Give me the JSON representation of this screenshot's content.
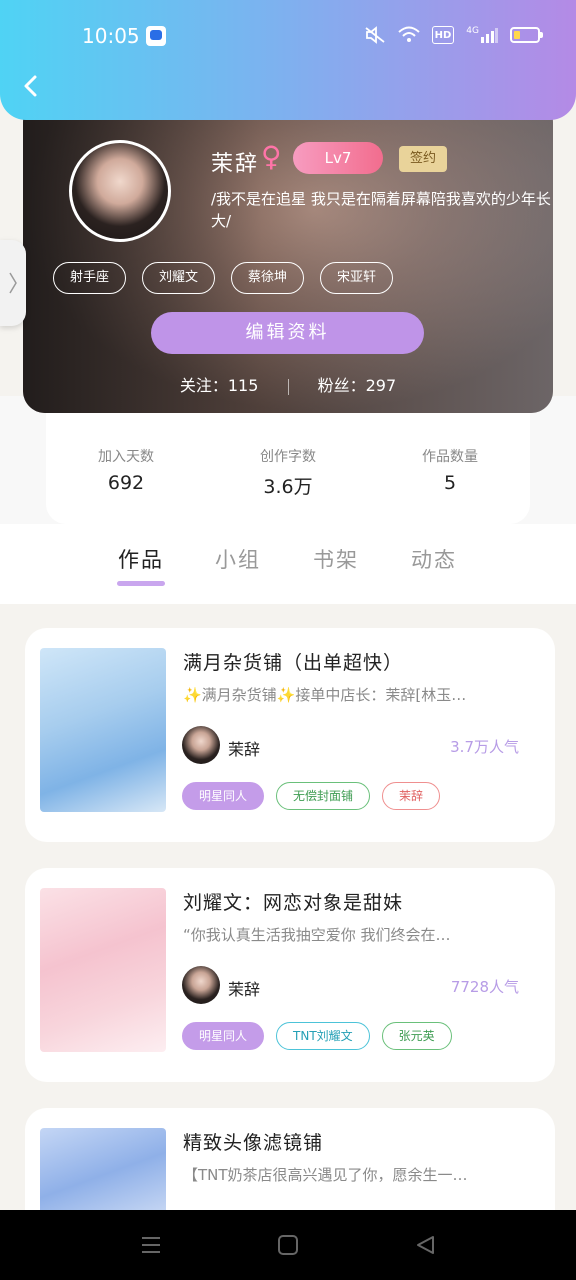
{
  "status_bar": {
    "time": "10:05",
    "network_label": "4G",
    "hd_label": "HD",
    "icons": [
      "mute-icon",
      "wifi-icon",
      "hd-icon",
      "signal-icon",
      "battery-icon"
    ]
  },
  "header": {
    "back_icon": "back-arrow-icon"
  },
  "profile": {
    "username": "茉辞",
    "gender_symbol": "♀",
    "level": "Lv7",
    "badge": "签约",
    "bio": "/我不是在追星 我只是在隔着屏幕陪我喜欢的少年长大/",
    "tags": [
      "射手座",
      "刘耀文",
      "蔡徐坤",
      "宋亚轩"
    ],
    "edit_button": "编辑资料",
    "follow_text": "关注：115",
    "fans_text": "粉丝：297"
  },
  "stats": [
    {
      "label": "加入天数",
      "value": "692"
    },
    {
      "label": "创作字数",
      "value": "3.6万"
    },
    {
      "label": "作品数量",
      "value": "5"
    }
  ],
  "tabs": [
    {
      "label": "作品",
      "active": true
    },
    {
      "label": "小组",
      "active": false
    },
    {
      "label": "书架",
      "active": false
    },
    {
      "label": "动态",
      "active": false
    }
  ],
  "works": [
    {
      "title": "满月杂货铺（出单超快）",
      "desc": "✨满月杂货铺✨接单中店长：茉辞[林玉…",
      "author": "茉辞",
      "popularity": "3.7万人气",
      "tags": [
        {
          "label": "明星同人",
          "style": "purple"
        },
        {
          "label": "无偿封面铺",
          "style": "green"
        },
        {
          "label": "茉辞",
          "style": "red"
        }
      ]
    },
    {
      "title": "刘耀文：网恋对象是甜妹",
      "desc": "“你我认真生活我抽空爱你 我们终会在…",
      "author": "茉辞",
      "popularity": "7728人气",
      "tags": [
        {
          "label": "明星同人",
          "style": "purple"
        },
        {
          "label": "TNT刘耀文",
          "style": "blue"
        },
        {
          "label": "张元英",
          "style": "green"
        }
      ]
    },
    {
      "title": "精致头像滤镜铺",
      "desc": "【TNT奶茶店很高兴遇见了你，愿余生一…",
      "author": "",
      "popularity": "",
      "tags": []
    }
  ],
  "colors": {
    "accent_purple": "#bf94e8",
    "header_gradient_start": "#4fd3f4",
    "header_gradient_end": "#b48ae6",
    "popularity": "#b79ce6"
  }
}
